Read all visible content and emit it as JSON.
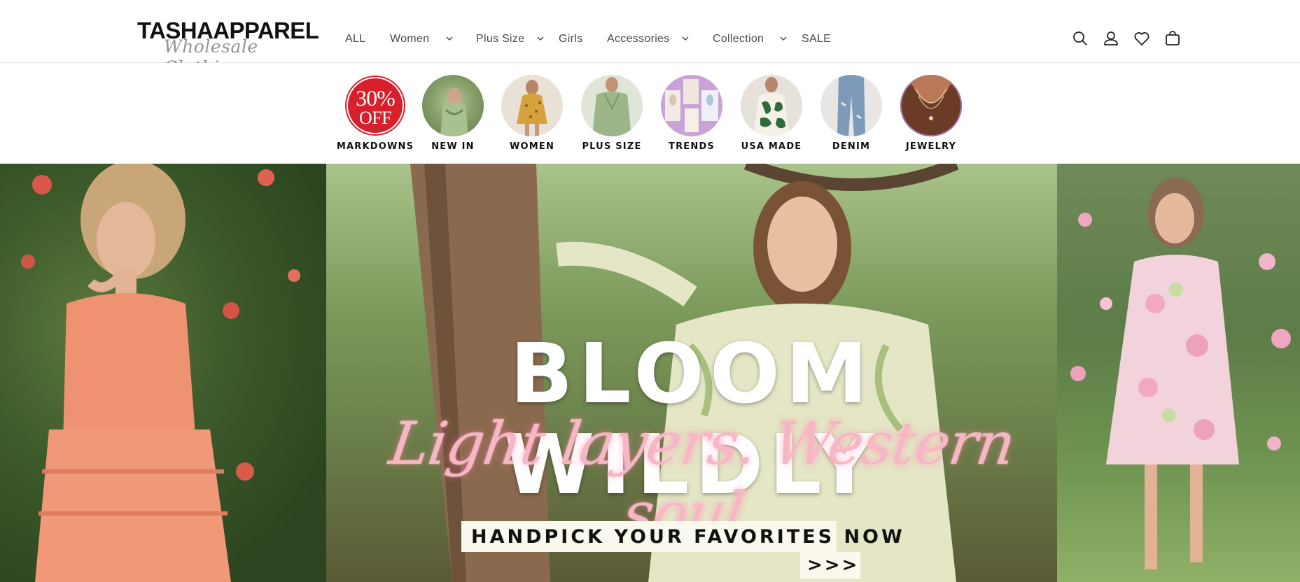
{
  "logo": {
    "main": "TASHAAPPAREL",
    "script": "Wholesale Clothing"
  },
  "nav": {
    "items": [
      {
        "label": "ALL",
        "has_dropdown": false
      },
      {
        "label": "Women",
        "has_dropdown": true
      },
      {
        "label": "Plus Size",
        "has_dropdown": true
      },
      {
        "label": "Girls",
        "has_dropdown": false
      },
      {
        "label": "Accessories",
        "has_dropdown": true
      },
      {
        "label": "Collection",
        "has_dropdown": true
      },
      {
        "label": "SALE",
        "has_dropdown": false
      }
    ]
  },
  "utility": {
    "icons": [
      "search-icon",
      "account-icon",
      "wishlist-heart-icon",
      "cart-icon"
    ]
  },
  "categories": [
    {
      "label": "MARKDOWNS",
      "badge_pct": "30%",
      "badge_off": "OFF"
    },
    {
      "label": "NEW IN"
    },
    {
      "label": "WOMEN"
    },
    {
      "label": "PLUS SIZE"
    },
    {
      "label": "TRENDS"
    },
    {
      "label": "USA MADE"
    },
    {
      "label": "DENIM"
    },
    {
      "label": "JEWELRY"
    }
  ],
  "hero": {
    "headline": "BLOOM WILDLY",
    "tagline": "Light layers. Western soul.",
    "cta": "HANDPICK YOUR FAVORITES NOW",
    "cta_arrow": ">>>"
  },
  "colors": {
    "accent_red": "#d81f2c",
    "tagline_pink": "#f6b6c4",
    "cta_bg": "#fbf8ee",
    "text_dark": "#111111"
  }
}
